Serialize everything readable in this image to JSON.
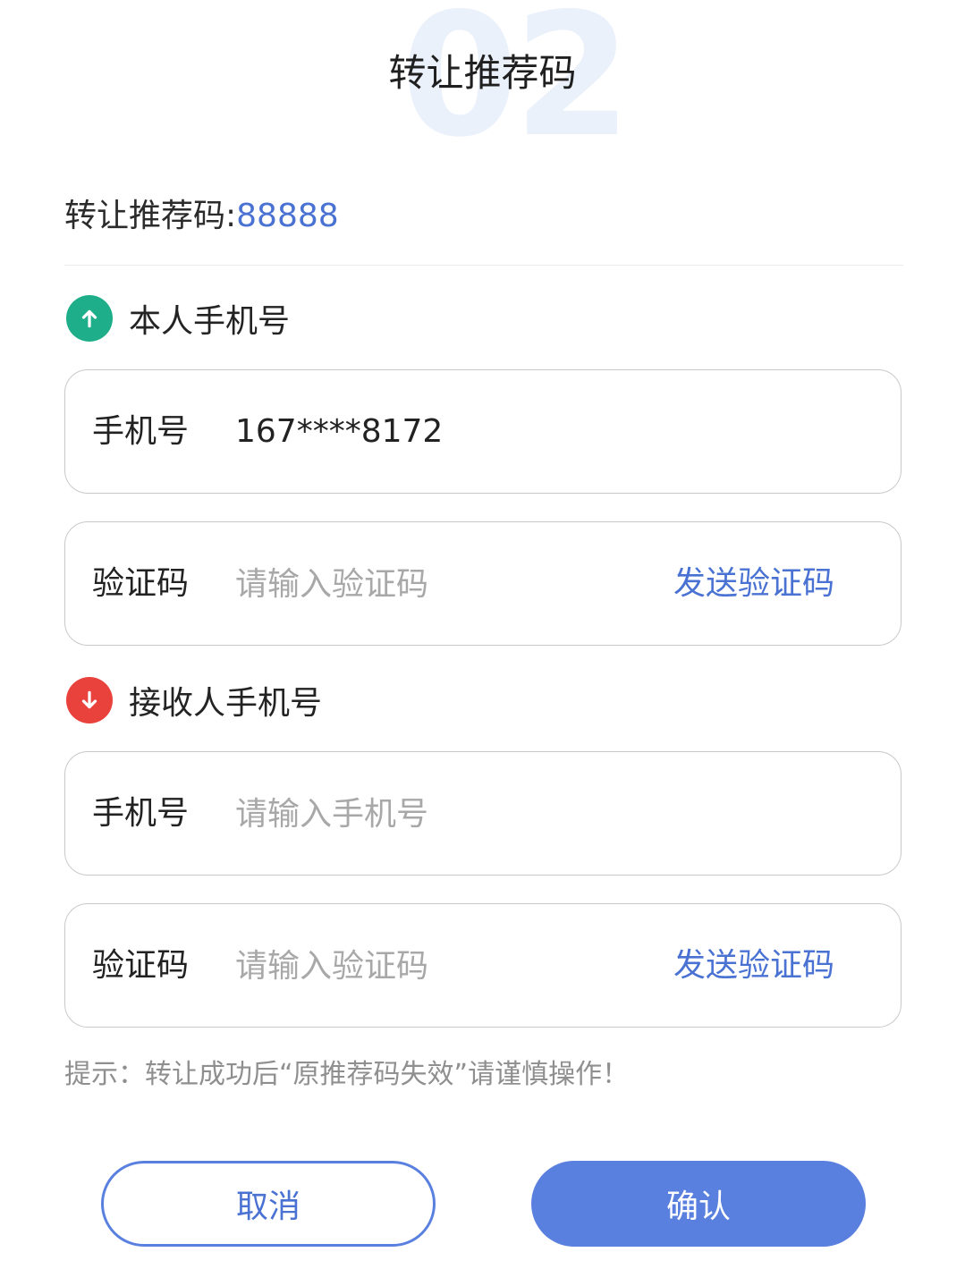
{
  "header": {
    "watermark": "02",
    "title": "转让推荐码"
  },
  "referral": {
    "label": "转让推荐码:",
    "value": "88888"
  },
  "self_section": {
    "title": "本人手机号",
    "icon": "arrow-up-icon",
    "color": "#1fae8a",
    "phone": {
      "label": "手机号",
      "value": "167****8172"
    },
    "code": {
      "label": "验证码",
      "placeholder": "请输入验证码",
      "send_label": "发送验证码"
    }
  },
  "recipient_section": {
    "title": "接收人手机号",
    "icon": "arrow-down-icon",
    "color": "#e9413b",
    "phone": {
      "label": "手机号",
      "placeholder": "请输入手机号"
    },
    "code": {
      "label": "验证码",
      "placeholder": "请输入验证码",
      "send_label": "发送验证码"
    }
  },
  "hint": "提示：转让成功后“原推荐码失效”请谨慎操作！",
  "actions": {
    "cancel_label": "取消",
    "confirm_label": "确认",
    "accent": "#5a80df"
  }
}
